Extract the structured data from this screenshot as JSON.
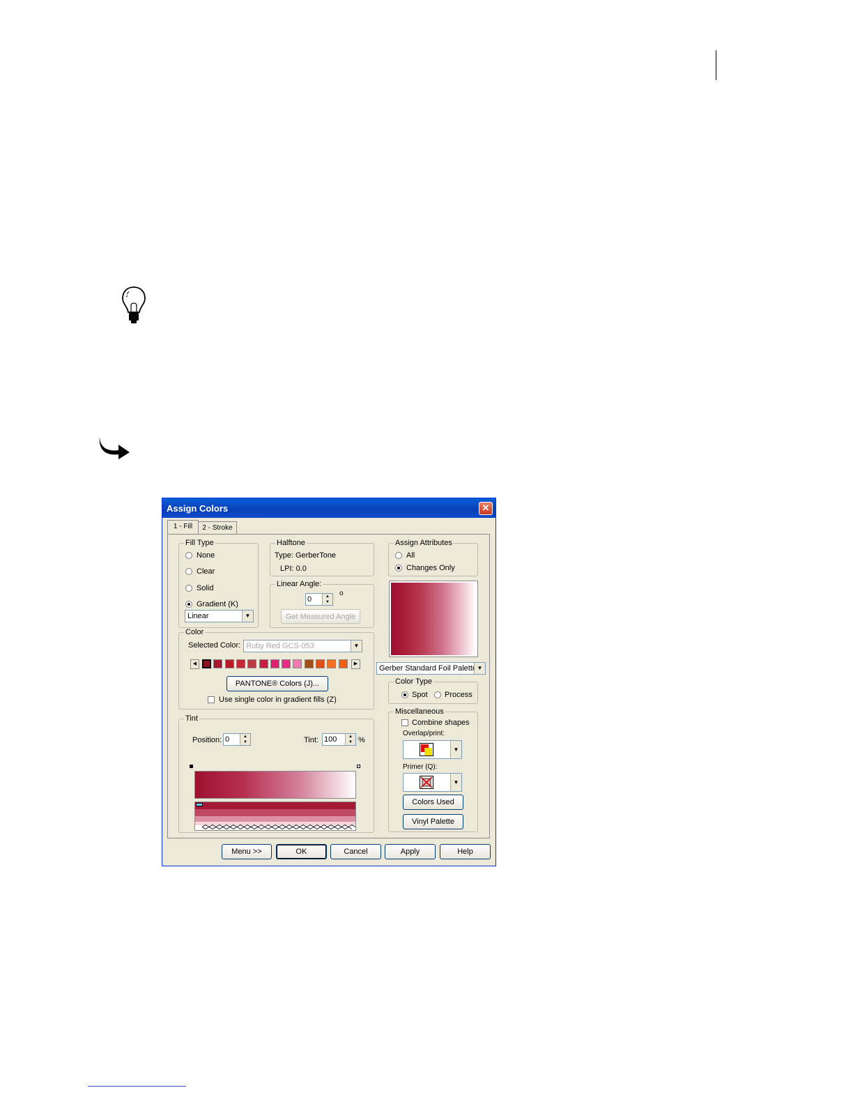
{
  "dialog": {
    "title": "Assign Colors",
    "close_glyph": "✕",
    "tabs": [
      {
        "label": "1 - Fill"
      },
      {
        "label": "2 - Stroke"
      }
    ]
  },
  "fill_type": {
    "legend": "Fill Type",
    "options": [
      {
        "label": "None",
        "selected": false
      },
      {
        "label": "Clear",
        "selected": false
      },
      {
        "label": "Solid",
        "selected": false
      },
      {
        "label": "Gradient (K)",
        "selected": true
      }
    ],
    "gradient_type": "Linear"
  },
  "halftone": {
    "legend": "Halftone",
    "type_text": "Type: GerberTone",
    "lpi_text": "LPI:  0.0"
  },
  "linear_angle": {
    "legend": "Linear Angle:",
    "value": "0",
    "degree_symbol": "o",
    "measure_button": "Get Measured Angle"
  },
  "assign_attributes": {
    "legend": "Assign Attributes",
    "options": [
      {
        "label": "All",
        "selected": false
      },
      {
        "label": "Changes Only",
        "selected": true
      }
    ]
  },
  "color": {
    "legend": "Color",
    "selected_label": "Selected Color:",
    "selected_value": "Ruby Red GCS-053",
    "swatches": [
      "#8e1426",
      "#a8172c",
      "#b81a28",
      "#c42838",
      "#b83a44",
      "#cc1c44",
      "#e02070",
      "#e82a86",
      "#f07ab0",
      "#a0501a",
      "#e0501a",
      "#f07020",
      "#f06010"
    ],
    "pantone_button": "PANTONE® Colors (J)...",
    "single_color_label": "Use single color in gradient fills (Z)",
    "single_color_checked": false
  },
  "palette": {
    "selected": "Gerber Standard Foil Palette"
  },
  "color_type": {
    "legend": "Color Type",
    "options": [
      {
        "label": "Spot",
        "selected": true
      },
      {
        "label": "Process",
        "selected": false
      }
    ]
  },
  "tint": {
    "legend": "Tint",
    "position_label": "Position:",
    "position_value": "0",
    "tint_label": "Tint:",
    "tint_value": "100",
    "percent": "%"
  },
  "miscellaneous": {
    "legend": "Miscellaneous",
    "combine_label": "Combine shapes",
    "combine_checked": false,
    "overlap_label": "Overlap/print:",
    "primer_label": "Primer (Q):",
    "colors_used_button": "Colors Used",
    "vinyl_palette_button": "Vinyl Palette"
  },
  "footer": {
    "menu_button": "Menu  >>",
    "ok_button": "OK",
    "cancel_button": "Cancel",
    "apply_button": "Apply",
    "help_button": "Help"
  },
  "colors": {
    "accent": "#0a3fb6",
    "gradient_start": "#9e1030",
    "gradient_end": "#ffffff"
  },
  "icons": {
    "tip": "lightbulb-icon",
    "step": "curved-arrow-icon"
  }
}
